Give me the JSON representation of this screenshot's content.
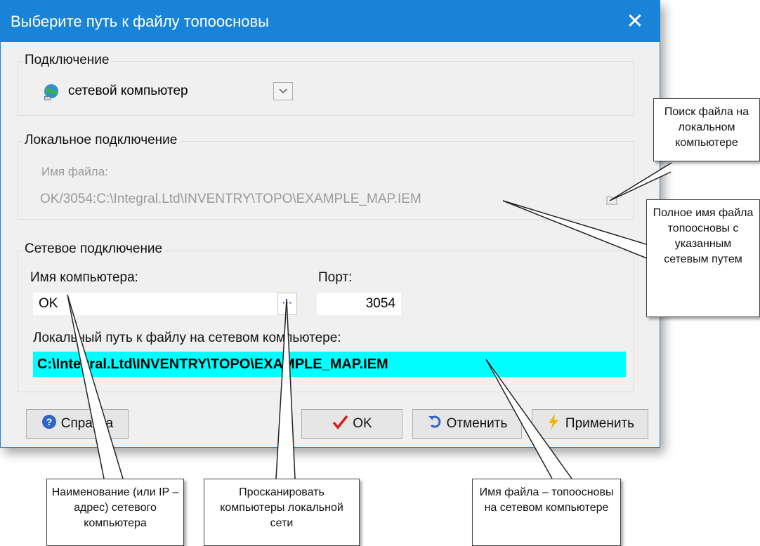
{
  "window": {
    "title": "Выберите путь к файлу топоосновы",
    "close_glyph": "✕"
  },
  "connection": {
    "legend": "Подключение",
    "selected": "сетевой компьютер",
    "icon": "network-globe-icon"
  },
  "local": {
    "legend": "Локальное подключение",
    "file_label": "Имя файла:",
    "file_value": "OK/3054:C:\\Integral.Ltd\\INVENTRY\\TOPO\\EXAMPLE_MAP.IEM"
  },
  "network": {
    "legend": "Сетевое подключение",
    "computer_label": "Имя компьютера:",
    "computer_value": "OK",
    "browse_label": "···",
    "port_label": "Порт:",
    "port_value": "3054",
    "path_label": "Локальный путь к файлу на сетевом компьютере:",
    "path_value": "C:\\Integral.Ltd\\INVENTRY\\TOPO\\EXAMPLE_MAP.IEM",
    "highlight_color": "#00ffff"
  },
  "buttons": {
    "help": "Справка",
    "ok": "OK",
    "cancel": "Отменить",
    "apply": "Применить"
  },
  "callouts": {
    "search_local": "Поиск файла на локальном компьютере",
    "full_name": "Полное имя файла топоосновы с указанным сетевым путем",
    "computer_name": "Наименование (или IP – адрес) сетевого компьютера",
    "scan": "Просканировать компьютеры локальной сети",
    "remote_file": "Имя файла – топоосновы на сетевом компьютере"
  }
}
